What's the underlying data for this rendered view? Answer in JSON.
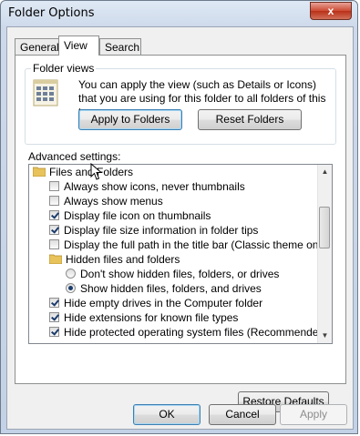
{
  "window": {
    "title": "Folder Options",
    "close_glyph": "x"
  },
  "tabs": [
    {
      "label": "General"
    },
    {
      "label": "View",
      "active": true
    },
    {
      "label": "Search"
    }
  ],
  "folder_views": {
    "legend": "Folder views",
    "description": "You can apply the view (such as Details or Icons) that you are using for this folder to all folders of this type.",
    "apply_button": "Apply to Folders",
    "reset_button": "Reset Folders",
    "icon": "folder-view-grid-icon"
  },
  "advanced": {
    "label": "Advanced settings:",
    "items": [
      {
        "kind": "folder",
        "label": "Files and Folders"
      },
      {
        "kind": "checkbox",
        "checked": false,
        "label": "Always show icons, never thumbnails"
      },
      {
        "kind": "checkbox",
        "checked": false,
        "label": "Always show menus"
      },
      {
        "kind": "checkbox",
        "checked": true,
        "label": "Display file icon on thumbnails"
      },
      {
        "kind": "checkbox",
        "checked": true,
        "label": "Display file size information in folder tips"
      },
      {
        "kind": "checkbox",
        "checked": false,
        "label": "Display the full path in the title bar (Classic theme only)"
      },
      {
        "kind": "folder",
        "label": "Hidden files and folders"
      },
      {
        "kind": "radio",
        "checked": false,
        "label": "Don't show hidden files, folders, or drives"
      },
      {
        "kind": "radio",
        "checked": true,
        "label": "Show hidden files, folders, and drives"
      },
      {
        "kind": "checkbox",
        "checked": true,
        "label": "Hide empty drives in the Computer folder"
      },
      {
        "kind": "checkbox",
        "checked": true,
        "label": "Hide extensions for known file types"
      },
      {
        "kind": "checkbox",
        "checked": true,
        "label": "Hide protected operating system files (Recommended)"
      }
    ]
  },
  "restore_button": "Restore Defaults",
  "footer": {
    "ok": "OK",
    "cancel": "Cancel",
    "apply": "Apply"
  },
  "colors": {
    "accent_border": "#3c7fb1",
    "check": "#1b3c6c",
    "folder": "#e8c25a"
  }
}
